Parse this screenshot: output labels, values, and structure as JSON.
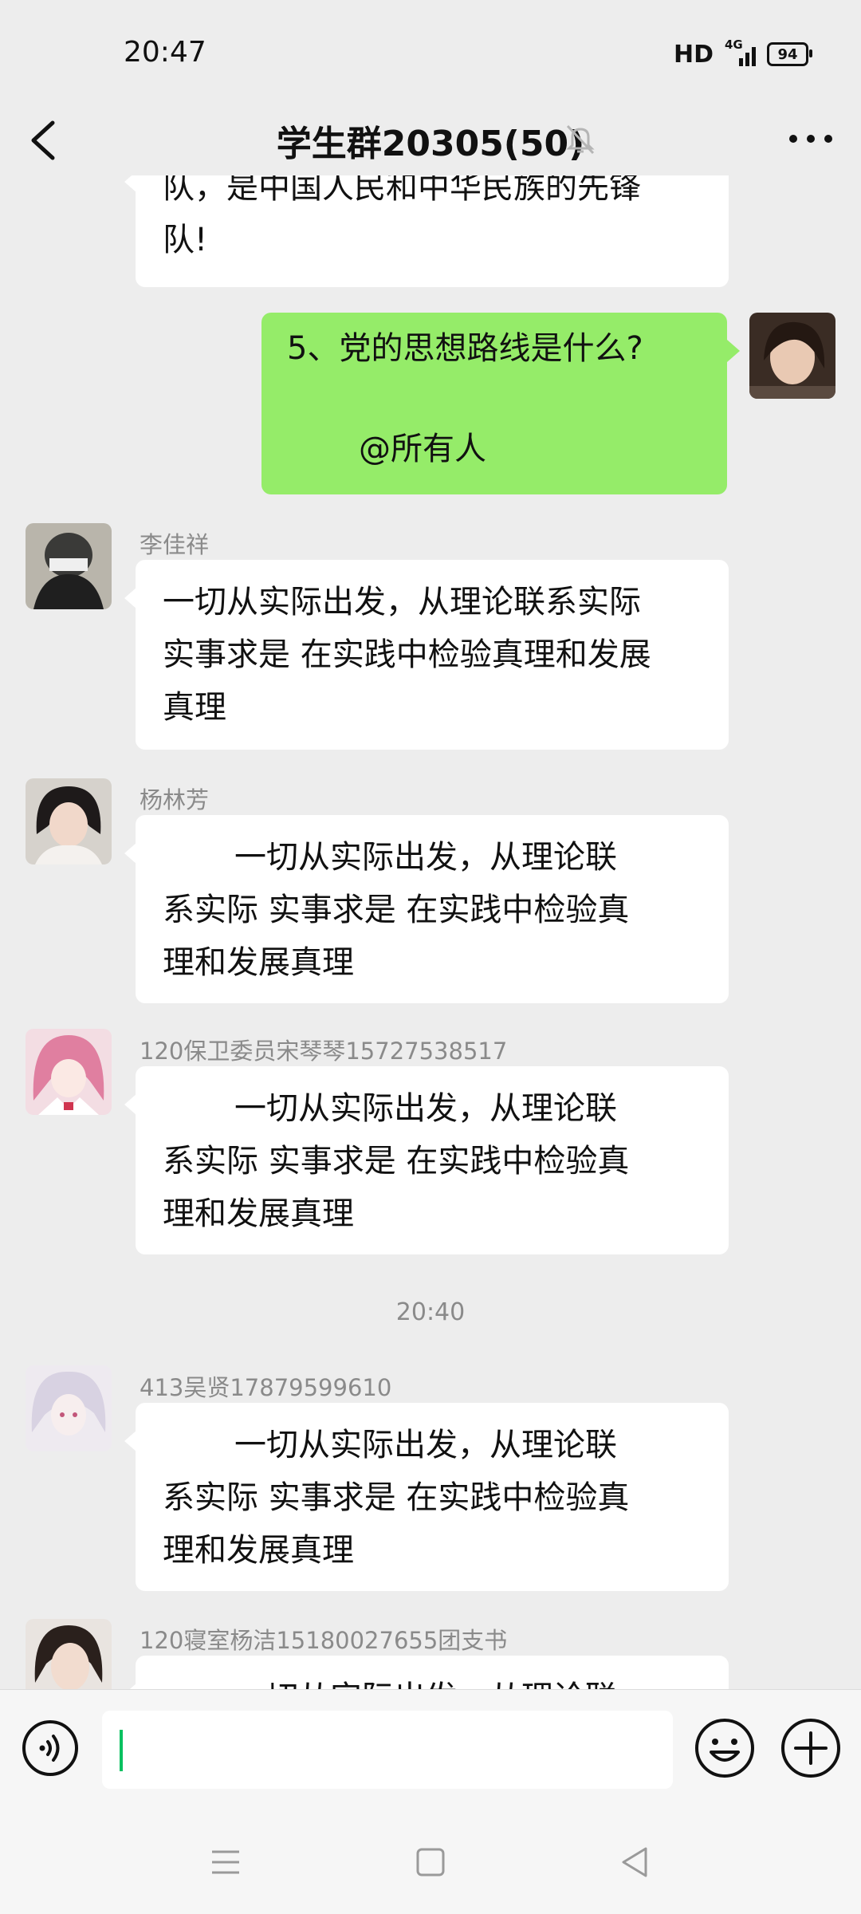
{
  "status_bar": {
    "time": "20:47",
    "hd": "HD",
    "network": "4G",
    "battery": "94"
  },
  "header": {
    "title": "学生群20305(50)"
  },
  "messages": [
    {
      "sender": "",
      "lines": [
        "队，是中国人民和中华民族的先锋",
        "队!"
      ]
    },
    {
      "sender": "",
      "lines": [
        "5、党的思想路线是什么?",
        "",
        "@所有人"
      ]
    },
    {
      "sender": "李佳祥",
      "lines": [
        "一切从实际出发，从理论联系实际",
        "实事求是 在实践中检验真理和发展",
        "真理"
      ]
    },
    {
      "sender": "杨林芳",
      "lines": [
        "一切从实际出发，从理论联",
        "系实际 实事求是 在实践中检验真",
        "理和发展真理"
      ]
    },
    {
      "sender": "120保卫委员宋琴琴15727538517",
      "lines": [
        "一切从实际出发，从理论联",
        "系实际 实事求是 在实践中检验真",
        "理和发展真理"
      ]
    },
    {
      "time": "20:40"
    },
    {
      "sender": "413吴贤17879599610",
      "lines": [
        "一切从实际出发，从理论联",
        "系实际 实事求是 在实践中检验真",
        "理和发展真理"
      ]
    },
    {
      "sender": "120寝室杨洁15180027655团支书",
      "lines": [
        "一切从实际出发，从理论联"
      ]
    }
  ],
  "input": {
    "value": ""
  },
  "colors": {
    "background": "#ededed",
    "self_bubble": "#95ec69",
    "other_bubble": "#ffffff",
    "caret": "#07c160"
  },
  "icons": {
    "back": "chevron-left-icon",
    "mute": "bell-off-icon",
    "more": "more-dots-icon",
    "voice": "voice-icon",
    "emoji": "emoji-icon",
    "plus": "plus-icon",
    "menu": "menu-icon",
    "home": "home-icon",
    "back_nav": "triangle-back-icon"
  }
}
